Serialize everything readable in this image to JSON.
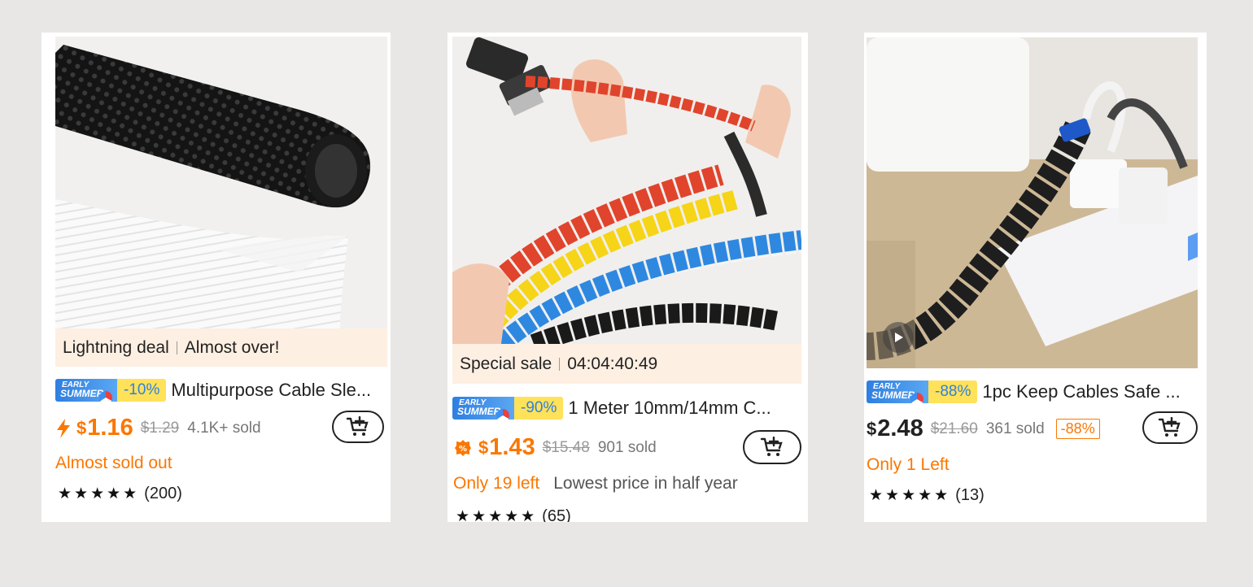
{
  "products": [
    {
      "banner_left": "Lightning deal",
      "banner_right": "Almost over!",
      "badge_label": "EARLY SUMMER",
      "badge_discount": "-10%",
      "title": "Multipurpose Cable Sle...",
      "currency": "$",
      "price": "1.16",
      "original_price": "$1.29",
      "sold": "4.1K+ sold",
      "stock_note": "Almost sold out",
      "rating_count": "(200)",
      "price_icon": "lightning-icon"
    },
    {
      "banner_left": "Special sale",
      "banner_right": "04:04:40:49",
      "badge_label": "EARLY SUMMER",
      "badge_discount": "-90%",
      "title": "1 Meter 10mm/14mm C...",
      "currency": "$",
      "price": "1.43",
      "original_price": "$15.48",
      "sold": "901 sold",
      "stock_note": "Only 19 left",
      "extra_note": "Lowest price in half year",
      "rating_count": "(65)",
      "price_icon": "percent-tag-icon"
    },
    {
      "badge_label": "EARLY SUMMER",
      "badge_discount": "-88%",
      "title": "1pc Keep Cables Safe ...",
      "currency": "$",
      "price": "2.48",
      "original_price": "$21.60",
      "sold": "361 sold",
      "discount_tag": "-88%",
      "stock_note": "Only 1 Left",
      "rating_count": "(13)",
      "media_icon": "play-icon"
    }
  ],
  "colors": {
    "accent": "#fb7701",
    "background": "#e8e7e5",
    "banner_bg": "#fdefe2"
  }
}
